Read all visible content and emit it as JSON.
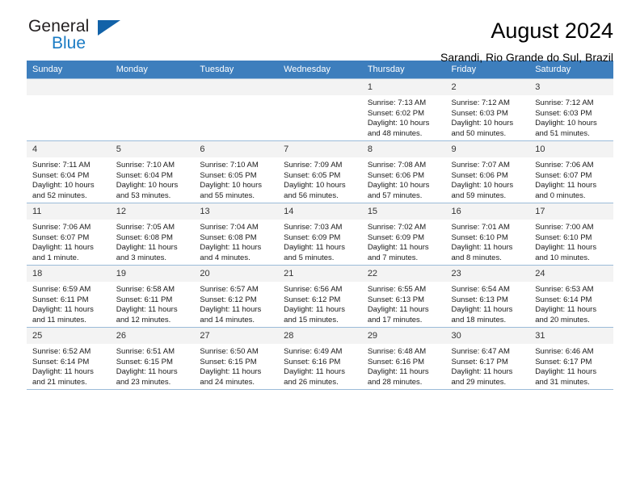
{
  "brand": {
    "name_part1": "General",
    "name_part2": "Blue",
    "accent_color": "#1a7bc4",
    "triangle_color": "#1262a8"
  },
  "header": {
    "title": "August 2024",
    "subtitle": "Sarandi, Rio Grande do Sul, Brazil"
  },
  "calendar": {
    "header_bg": "#3d7ebd",
    "weekdays": [
      "Sunday",
      "Monday",
      "Tuesday",
      "Wednesday",
      "Thursday",
      "Friday",
      "Saturday"
    ],
    "weeks": [
      [
        {
          "day": "",
          "sunrise": "",
          "sunset": "",
          "daylight_1": "",
          "daylight_2": ""
        },
        {
          "day": "",
          "sunrise": "",
          "sunset": "",
          "daylight_1": "",
          "daylight_2": ""
        },
        {
          "day": "",
          "sunrise": "",
          "sunset": "",
          "daylight_1": "",
          "daylight_2": ""
        },
        {
          "day": "",
          "sunrise": "",
          "sunset": "",
          "daylight_1": "",
          "daylight_2": ""
        },
        {
          "day": "1",
          "sunrise": "Sunrise: 7:13 AM",
          "sunset": "Sunset: 6:02 PM",
          "daylight_1": "Daylight: 10 hours",
          "daylight_2": "and 48 minutes."
        },
        {
          "day": "2",
          "sunrise": "Sunrise: 7:12 AM",
          "sunset": "Sunset: 6:03 PM",
          "daylight_1": "Daylight: 10 hours",
          "daylight_2": "and 50 minutes."
        },
        {
          "day": "3",
          "sunrise": "Sunrise: 7:12 AM",
          "sunset": "Sunset: 6:03 PM",
          "daylight_1": "Daylight: 10 hours",
          "daylight_2": "and 51 minutes."
        }
      ],
      [
        {
          "day": "4",
          "sunrise": "Sunrise: 7:11 AM",
          "sunset": "Sunset: 6:04 PM",
          "daylight_1": "Daylight: 10 hours",
          "daylight_2": "and 52 minutes."
        },
        {
          "day": "5",
          "sunrise": "Sunrise: 7:10 AM",
          "sunset": "Sunset: 6:04 PM",
          "daylight_1": "Daylight: 10 hours",
          "daylight_2": "and 53 minutes."
        },
        {
          "day": "6",
          "sunrise": "Sunrise: 7:10 AM",
          "sunset": "Sunset: 6:05 PM",
          "daylight_1": "Daylight: 10 hours",
          "daylight_2": "and 55 minutes."
        },
        {
          "day": "7",
          "sunrise": "Sunrise: 7:09 AM",
          "sunset": "Sunset: 6:05 PM",
          "daylight_1": "Daylight: 10 hours",
          "daylight_2": "and 56 minutes."
        },
        {
          "day": "8",
          "sunrise": "Sunrise: 7:08 AM",
          "sunset": "Sunset: 6:06 PM",
          "daylight_1": "Daylight: 10 hours",
          "daylight_2": "and 57 minutes."
        },
        {
          "day": "9",
          "sunrise": "Sunrise: 7:07 AM",
          "sunset": "Sunset: 6:06 PM",
          "daylight_1": "Daylight: 10 hours",
          "daylight_2": "and 59 minutes."
        },
        {
          "day": "10",
          "sunrise": "Sunrise: 7:06 AM",
          "sunset": "Sunset: 6:07 PM",
          "daylight_1": "Daylight: 11 hours",
          "daylight_2": "and 0 minutes."
        }
      ],
      [
        {
          "day": "11",
          "sunrise": "Sunrise: 7:06 AM",
          "sunset": "Sunset: 6:07 PM",
          "daylight_1": "Daylight: 11 hours",
          "daylight_2": "and 1 minute."
        },
        {
          "day": "12",
          "sunrise": "Sunrise: 7:05 AM",
          "sunset": "Sunset: 6:08 PM",
          "daylight_1": "Daylight: 11 hours",
          "daylight_2": "and 3 minutes."
        },
        {
          "day": "13",
          "sunrise": "Sunrise: 7:04 AM",
          "sunset": "Sunset: 6:08 PM",
          "daylight_1": "Daylight: 11 hours",
          "daylight_2": "and 4 minutes."
        },
        {
          "day": "14",
          "sunrise": "Sunrise: 7:03 AM",
          "sunset": "Sunset: 6:09 PM",
          "daylight_1": "Daylight: 11 hours",
          "daylight_2": "and 5 minutes."
        },
        {
          "day": "15",
          "sunrise": "Sunrise: 7:02 AM",
          "sunset": "Sunset: 6:09 PM",
          "daylight_1": "Daylight: 11 hours",
          "daylight_2": "and 7 minutes."
        },
        {
          "day": "16",
          "sunrise": "Sunrise: 7:01 AM",
          "sunset": "Sunset: 6:10 PM",
          "daylight_1": "Daylight: 11 hours",
          "daylight_2": "and 8 minutes."
        },
        {
          "day": "17",
          "sunrise": "Sunrise: 7:00 AM",
          "sunset": "Sunset: 6:10 PM",
          "daylight_1": "Daylight: 11 hours",
          "daylight_2": "and 10 minutes."
        }
      ],
      [
        {
          "day": "18",
          "sunrise": "Sunrise: 6:59 AM",
          "sunset": "Sunset: 6:11 PM",
          "daylight_1": "Daylight: 11 hours",
          "daylight_2": "and 11 minutes."
        },
        {
          "day": "19",
          "sunrise": "Sunrise: 6:58 AM",
          "sunset": "Sunset: 6:11 PM",
          "daylight_1": "Daylight: 11 hours",
          "daylight_2": "and 12 minutes."
        },
        {
          "day": "20",
          "sunrise": "Sunrise: 6:57 AM",
          "sunset": "Sunset: 6:12 PM",
          "daylight_1": "Daylight: 11 hours",
          "daylight_2": "and 14 minutes."
        },
        {
          "day": "21",
          "sunrise": "Sunrise: 6:56 AM",
          "sunset": "Sunset: 6:12 PM",
          "daylight_1": "Daylight: 11 hours",
          "daylight_2": "and 15 minutes."
        },
        {
          "day": "22",
          "sunrise": "Sunrise: 6:55 AM",
          "sunset": "Sunset: 6:13 PM",
          "daylight_1": "Daylight: 11 hours",
          "daylight_2": "and 17 minutes."
        },
        {
          "day": "23",
          "sunrise": "Sunrise: 6:54 AM",
          "sunset": "Sunset: 6:13 PM",
          "daylight_1": "Daylight: 11 hours",
          "daylight_2": "and 18 minutes."
        },
        {
          "day": "24",
          "sunrise": "Sunrise: 6:53 AM",
          "sunset": "Sunset: 6:14 PM",
          "daylight_1": "Daylight: 11 hours",
          "daylight_2": "and 20 minutes."
        }
      ],
      [
        {
          "day": "25",
          "sunrise": "Sunrise: 6:52 AM",
          "sunset": "Sunset: 6:14 PM",
          "daylight_1": "Daylight: 11 hours",
          "daylight_2": "and 21 minutes."
        },
        {
          "day": "26",
          "sunrise": "Sunrise: 6:51 AM",
          "sunset": "Sunset: 6:15 PM",
          "daylight_1": "Daylight: 11 hours",
          "daylight_2": "and 23 minutes."
        },
        {
          "day": "27",
          "sunrise": "Sunrise: 6:50 AM",
          "sunset": "Sunset: 6:15 PM",
          "daylight_1": "Daylight: 11 hours",
          "daylight_2": "and 24 minutes."
        },
        {
          "day": "28",
          "sunrise": "Sunrise: 6:49 AM",
          "sunset": "Sunset: 6:16 PM",
          "daylight_1": "Daylight: 11 hours",
          "daylight_2": "and 26 minutes."
        },
        {
          "day": "29",
          "sunrise": "Sunrise: 6:48 AM",
          "sunset": "Sunset: 6:16 PM",
          "daylight_1": "Daylight: 11 hours",
          "daylight_2": "and 28 minutes."
        },
        {
          "day": "30",
          "sunrise": "Sunrise: 6:47 AM",
          "sunset": "Sunset: 6:17 PM",
          "daylight_1": "Daylight: 11 hours",
          "daylight_2": "and 29 minutes."
        },
        {
          "day": "31",
          "sunrise": "Sunrise: 6:46 AM",
          "sunset": "Sunset: 6:17 PM",
          "daylight_1": "Daylight: 11 hours",
          "daylight_2": "and 31 minutes."
        }
      ]
    ]
  }
}
